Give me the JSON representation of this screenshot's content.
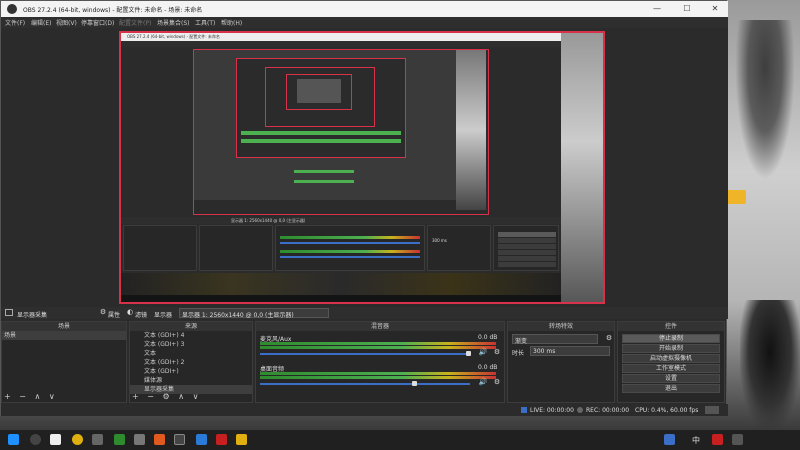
{
  "window": {
    "title": "OBS 27.2.4 (64-bit, windows) - 配置文件: 未命名 - 场景: 未命名",
    "controls": {
      "minimize": "—",
      "maximize": "☐",
      "close": "✕"
    }
  },
  "menu": [
    "文件(F)",
    "编辑(E)",
    "视图(V)",
    "停靠窗口(D)",
    "配置文件(P)",
    "场景集合(S)",
    "工具(T)",
    "帮助(H)"
  ],
  "source_bar": {
    "label": "显示器采集",
    "properties": "属性",
    "filters": "滤镜",
    "display_label": "显示器",
    "display_value": "显示器 1: 2560x1440 @ 0,0 (主显示器)"
  },
  "scenes": {
    "title": "场景",
    "items": [
      "场景"
    ]
  },
  "sources": {
    "title": "来源",
    "items": [
      "文本 (GDI+) 4",
      "文本 (GDI+) 3",
      "文本",
      "文本 (GDI+) 2",
      "文本 (GDI+)",
      "媒体源",
      "显示器采集"
    ]
  },
  "mixer": {
    "title": "混音器",
    "tracks": [
      {
        "name": "麦克风/Aux",
        "db": "0.0 dB"
      },
      {
        "name": "桌面音频",
        "db": "0.0 dB"
      }
    ],
    "scale": [
      "-60",
      "-55",
      "-50",
      "-45",
      "-40",
      "-35",
      "-30",
      "-25",
      "-20",
      "-15",
      "-10",
      "-5",
      "0"
    ]
  },
  "transitions": {
    "title": "转场特效",
    "type": "渐变",
    "duration_label": "时长",
    "duration_value": "300 ms"
  },
  "controls": {
    "title": "控件",
    "buttons": [
      "停止录制",
      "开始录制",
      "启动虚拟摄像机",
      "工作室模式",
      "设置",
      "退出"
    ]
  },
  "status": {
    "live": "LIVE: 00:00:00",
    "rec": "REC: 00:00:00",
    "cpu": "CPU: 0.4%, 60.00 fps"
  },
  "nested_window": {
    "title": "OBS 27.2.4 (64-bit, windows) - 配置文件: 未命名",
    "display_value": "显示器 1: 2560x1440 @ 0,0 (主显示器)",
    "duration_value": "300 ms"
  },
  "taskbar": {
    "ime": "中",
    "icons": [
      "windows-start-icon",
      "search-icon",
      "file-explorer-icon",
      "night-icon",
      "obs-icon",
      "xbox-icon",
      "app-icon",
      "chrome-icon",
      "app-icon-2",
      "obs-active-icon",
      "app-icon-3",
      "app-icon-4",
      "app-icon-5"
    ]
  },
  "colors": {
    "accent_red": "#d8324a",
    "meter_green": "#4caf50",
    "meter_yellow": "#c8b21c",
    "volume_blue": "#3b6ec7"
  }
}
